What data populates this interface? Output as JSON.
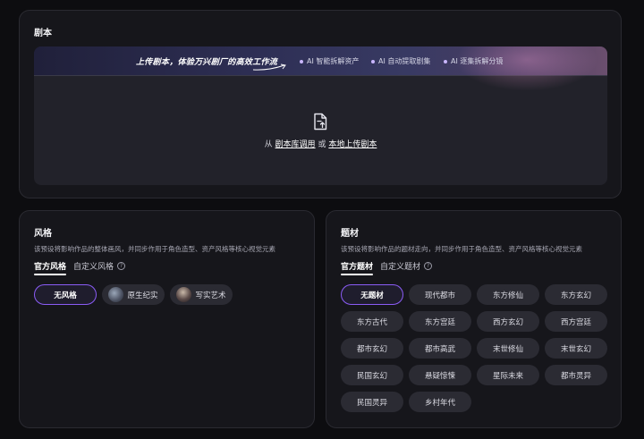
{
  "script_panel": {
    "title": "剧本",
    "banner": {
      "slogan": "上传剧本，体验万兴剧厂的高效工作流",
      "features": [
        "AI 智能拆解资产",
        "AI 自动提取剧集",
        "AI 逐集拆解分镜"
      ]
    },
    "upload": {
      "prefix": "从",
      "library_link": "剧本库调用",
      "or": "或",
      "local_link": "本地上传剧本"
    }
  },
  "style_panel": {
    "title": "风格",
    "description": "该预设将影响作品的整体画风，并同步作用于角色造型、资产风格等核心视觉元素",
    "tabs": [
      "官方风格",
      "自定义风格"
    ],
    "active_tab": "官方风格",
    "options": [
      {
        "label": "无风格",
        "selected": true
      },
      {
        "label": "原生纪实",
        "selected": false
      },
      {
        "label": "写实艺术",
        "selected": false
      }
    ]
  },
  "subject_panel": {
    "title": "题材",
    "description": "该预设将影响作品的题材走向，并同步作用于角色造型、资产风格等核心视觉元素",
    "tabs": [
      "官方题材",
      "自定义题材"
    ],
    "active_tab": "官方题材",
    "options": [
      {
        "label": "无题材",
        "selected": true
      },
      {
        "label": "现代都市",
        "selected": false
      },
      {
        "label": "东方修仙",
        "selected": false
      },
      {
        "label": "东方玄幻",
        "selected": false
      },
      {
        "label": "东方古代",
        "selected": false
      },
      {
        "label": "东方宫廷",
        "selected": false
      },
      {
        "label": "西方玄幻",
        "selected": false
      },
      {
        "label": "西方宫廷",
        "selected": false
      },
      {
        "label": "都市玄幻",
        "selected": false
      },
      {
        "label": "都市高武",
        "selected": false
      },
      {
        "label": "末世修仙",
        "selected": false
      },
      {
        "label": "末世玄幻",
        "selected": false
      },
      {
        "label": "民国玄幻",
        "selected": false
      },
      {
        "label": "悬疑惊悚",
        "selected": false
      },
      {
        "label": "星际未来",
        "selected": false
      },
      {
        "label": "都市灵异",
        "selected": false
      },
      {
        "label": "民国灵异",
        "selected": false
      },
      {
        "label": "乡村年代",
        "selected": false
      }
    ]
  },
  "colors": {
    "accent": "#8b5cf6",
    "panel_bg": "#16161b",
    "page_bg": "#0d0d10"
  }
}
